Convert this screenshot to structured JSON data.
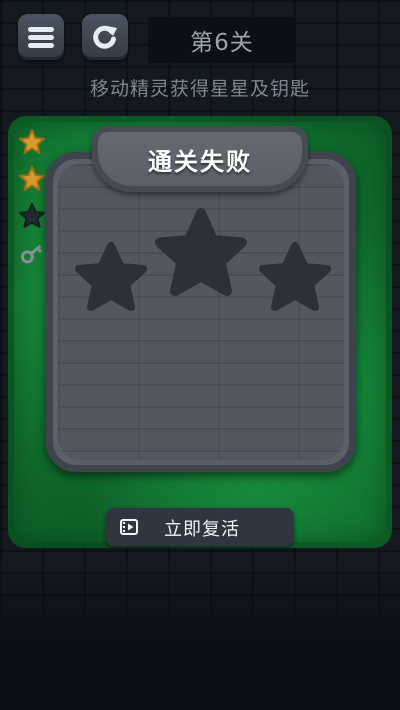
{
  "top_bar": {
    "menu_icon": "menu-icon",
    "restart_icon": "restart-icon",
    "level_label": "第6关"
  },
  "objective": "移动精灵获得星星及钥匙",
  "side_items": [
    {
      "icon": "star-icon",
      "state": "collected",
      "color": "#d49a2a"
    },
    {
      "icon": "star-icon",
      "state": "collected",
      "color": "#d49a2a"
    },
    {
      "icon": "star-icon",
      "state": "empty",
      "color": "#1f2a33"
    },
    {
      "icon": "key-icon",
      "state": "missing",
      "color": "#8a8f96"
    }
  ],
  "result_panel": {
    "title": "通关失败",
    "stars_earned": 0,
    "stars_total": 3,
    "empty_star_color": "#2c3038"
  },
  "revive_button": {
    "icon": "video-icon",
    "label": "立即复活"
  },
  "colors": {
    "board_green": "#178a3b",
    "panel_gray": "#5b5f69"
  }
}
